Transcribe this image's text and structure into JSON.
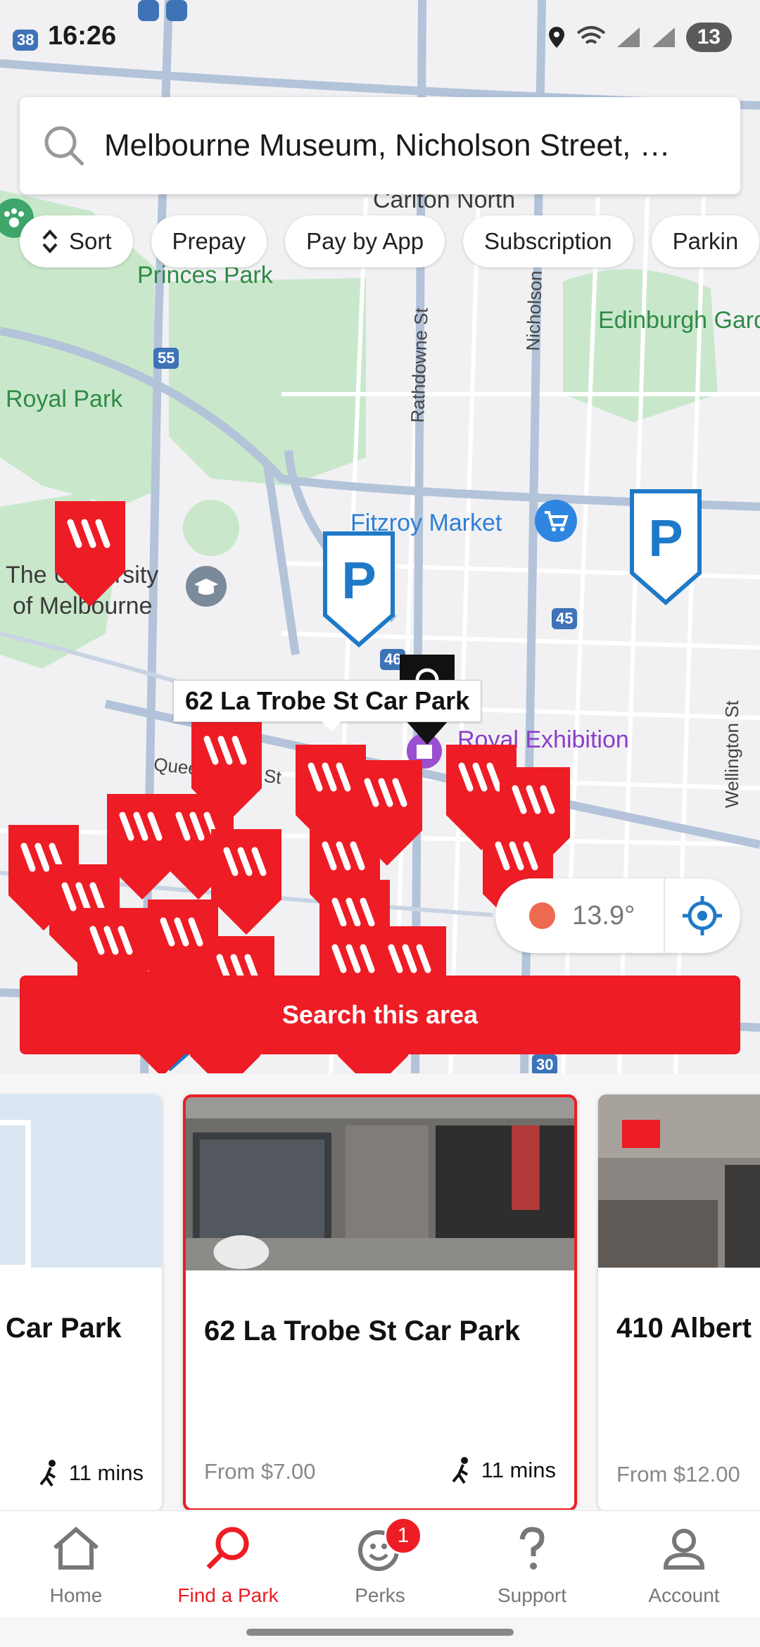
{
  "status_bar": {
    "time": "16:26",
    "route_badge": "38",
    "battery": "13"
  },
  "search": {
    "query": "Melbourne Museum, Nicholson Street, …"
  },
  "filters": [
    "Sort",
    "Prepay",
    "Pay by App",
    "Subscription",
    "Parkin"
  ],
  "map_labels": {
    "carlton_north": "Carlton North",
    "princes_park": "Princes Park",
    "royal_park": "Royal Park",
    "edinburgh_gardens": "Edinburgh Gardens",
    "rathdowne": "Rathdowne St",
    "nicholson": "Nicholson",
    "fitzroy_market": "Fitzroy Market",
    "uni_1": "The University",
    "uni_2": "of Melbourne",
    "royal_exhibition": "Royal Exhibition",
    "wellington": "Wellington St",
    "queen": "Queensberry St",
    "route_55": "55",
    "route_45a": "45",
    "route_45b": "45",
    "route_30": "30",
    "route_46": "46"
  },
  "selected_marker_label": "62 La Trobe St Car Park",
  "weather": {
    "temperature": "13.9°"
  },
  "search_area_button": "Search this area",
  "cards": [
    {
      "title": "Car Park",
      "price": "",
      "walk": "11 mins"
    },
    {
      "title": "62 La Trobe St Car Park",
      "price": "From $7.00",
      "walk": "11 mins"
    },
    {
      "title": "410 Albert",
      "price": "From $12.00",
      "walk": ""
    }
  ],
  "nav": {
    "home": "Home",
    "find": "Find a Park",
    "perks": "Perks",
    "perks_badge": "1",
    "support": "Support",
    "account": "Account"
  },
  "colors": {
    "brand_red": "#ee1c24",
    "park_blue": "#1e7ac8",
    "park_green": "#c5e6c6"
  }
}
